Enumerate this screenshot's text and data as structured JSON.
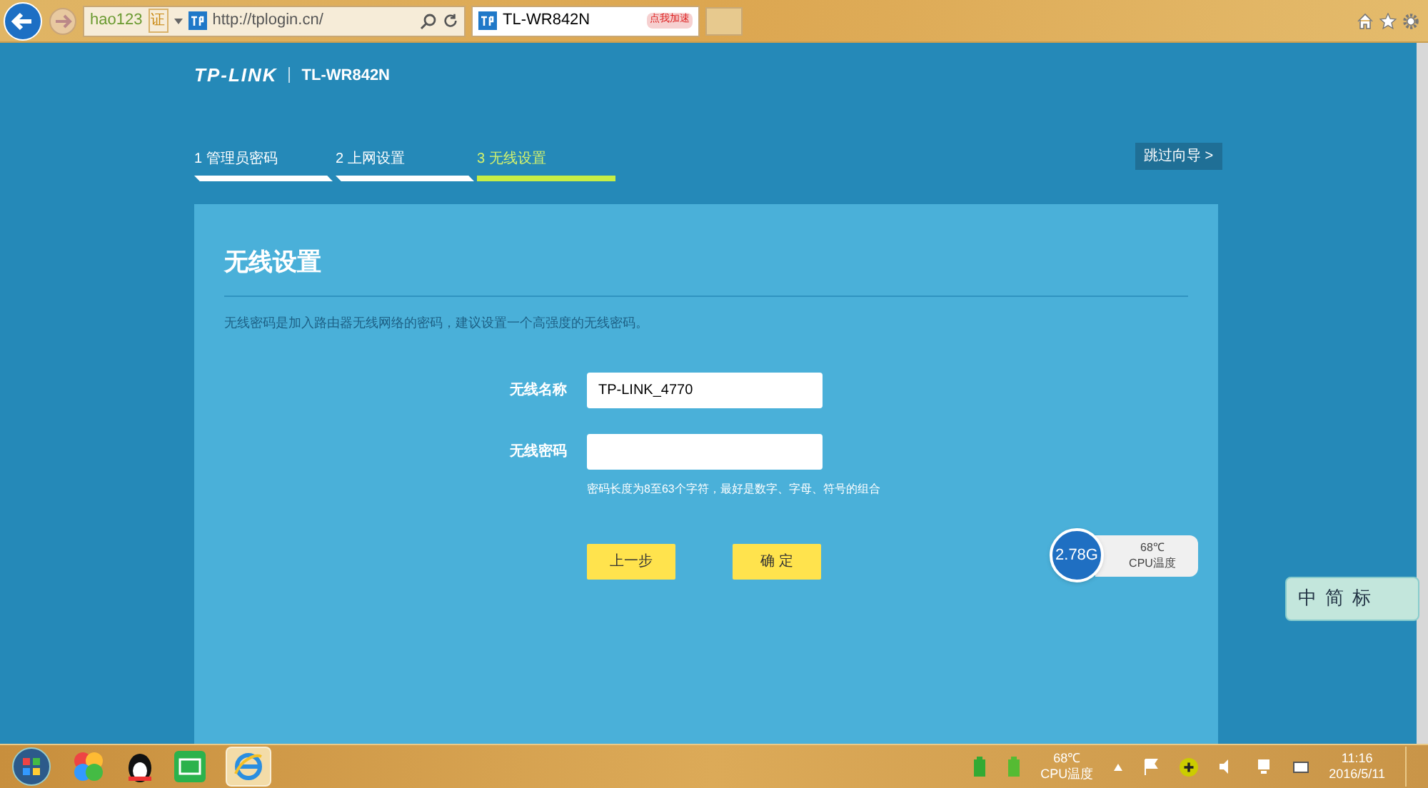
{
  "browser": {
    "favorite": "hao123",
    "favorite_badge": "证",
    "address": "http://tplogin.cn/",
    "tab": {
      "title": "TL-WR842N",
      "selected": true
    },
    "ad_badge": "点我加速"
  },
  "header": {
    "brand": "TP-LINK",
    "model": "TL-WR842N"
  },
  "steps": [
    {
      "label": "1 管理员密码",
      "selected": false
    },
    {
      "label": "2 上网设置",
      "selected": false
    },
    {
      "label": "3 无线设置",
      "selected": true
    }
  ],
  "skip_button": "跳过向导 >",
  "card": {
    "title": "无线设置",
    "description": "无线密码是加入路由器无线网络的密码，建议设置一个高强度的无线密码。",
    "fields": [
      {
        "label": "无线名称",
        "value": "TP-LINK_4770"
      },
      {
        "label": "无线密码",
        "hint": "密码长度为8至63个字符，最好是数字、字母、符号的组合"
      }
    ],
    "buttons": [
      "上一步",
      "确 定"
    ]
  },
  "cpu_widget": {
    "speed": "2.78G",
    "temperature": "68℃",
    "caption": "CPU温度"
  },
  "ime_badge": "中简标",
  "taskbar": {
    "temperature": "68℃",
    "caption": "CPU温度",
    "time": "11:16",
    "date": "2016/5/11"
  }
}
